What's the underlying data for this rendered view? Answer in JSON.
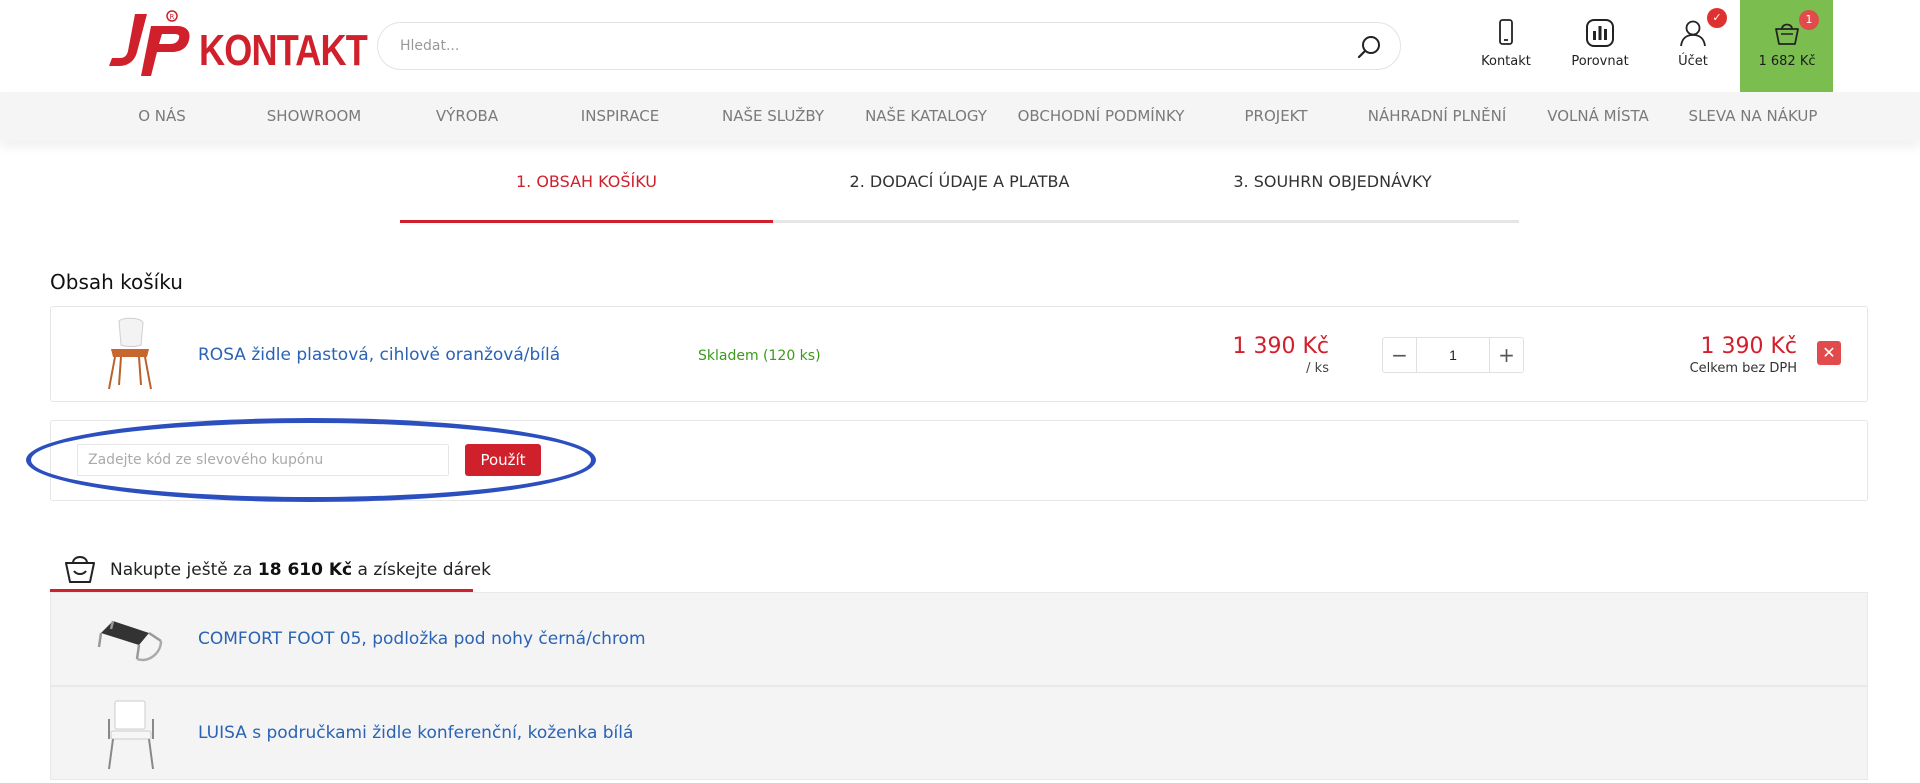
{
  "header": {
    "logo_text": "KONTAKT",
    "search_placeholder": "Hledat...",
    "contact_label": "Kontakt",
    "compare_label": "Porovnat",
    "account_label": "Účet",
    "account_badge": "✓",
    "cart_count": "1",
    "cart_total": "1 682 Kč",
    "cart_bg_color": "#7bbe4f"
  },
  "nav": {
    "items": [
      {
        "label": "O NÁS"
      },
      {
        "label": "SHOWROOM"
      },
      {
        "label": "VÝROBA"
      },
      {
        "label": "INSPIRACE"
      },
      {
        "label": "NAŠE SLUŽBY"
      },
      {
        "label": "NAŠE KATALOGY"
      },
      {
        "label": "OBCHODNÍ PODMÍNKY"
      },
      {
        "label": "PROJEKT"
      },
      {
        "label": "NÁHRADNÍ PLNĚNÍ"
      },
      {
        "label": "VOLNÁ MÍSTA"
      },
      {
        "label": "SLEVA NA NÁKUP"
      }
    ]
  },
  "steps": [
    {
      "label": "1. OBSAH KOŠÍKU",
      "active": true
    },
    {
      "label": "2. DODACÍ ÚDAJE A PLATBA",
      "active": false
    },
    {
      "label": "3. SOUHRN OBJEDNÁVKY",
      "active": false
    }
  ],
  "cart": {
    "title": "Obsah košíku",
    "item": {
      "name": "ROSA židle plastová, cihlově oranžová/bílá",
      "stock": "Skladem (120 ks)",
      "unit_price": "1 390 Kč",
      "unit_suffix": "/ ks",
      "quantity": "1",
      "total_price": "1 390 Kč",
      "total_note": "Celkem bez DPH"
    }
  },
  "coupon": {
    "placeholder": "Zadejte kód ze slevového kupónu",
    "button_label": "Použít"
  },
  "gift": {
    "text_before": "Nakupte ještě za",
    "amount": "18 610 Kč",
    "text_after": "a získejte dárek",
    "items": [
      {
        "name": "COMFORT FOOT 05, podložka pod nohy černá/chrom"
      },
      {
        "name": "LUISA s područkami židle konferenční, koženka bílá"
      }
    ]
  },
  "colors": {
    "brand_red": "#d0202c",
    "link_blue": "#2a63b5",
    "stock_green": "#3a9a1a",
    "annotation_blue": "#2c4fc0"
  }
}
